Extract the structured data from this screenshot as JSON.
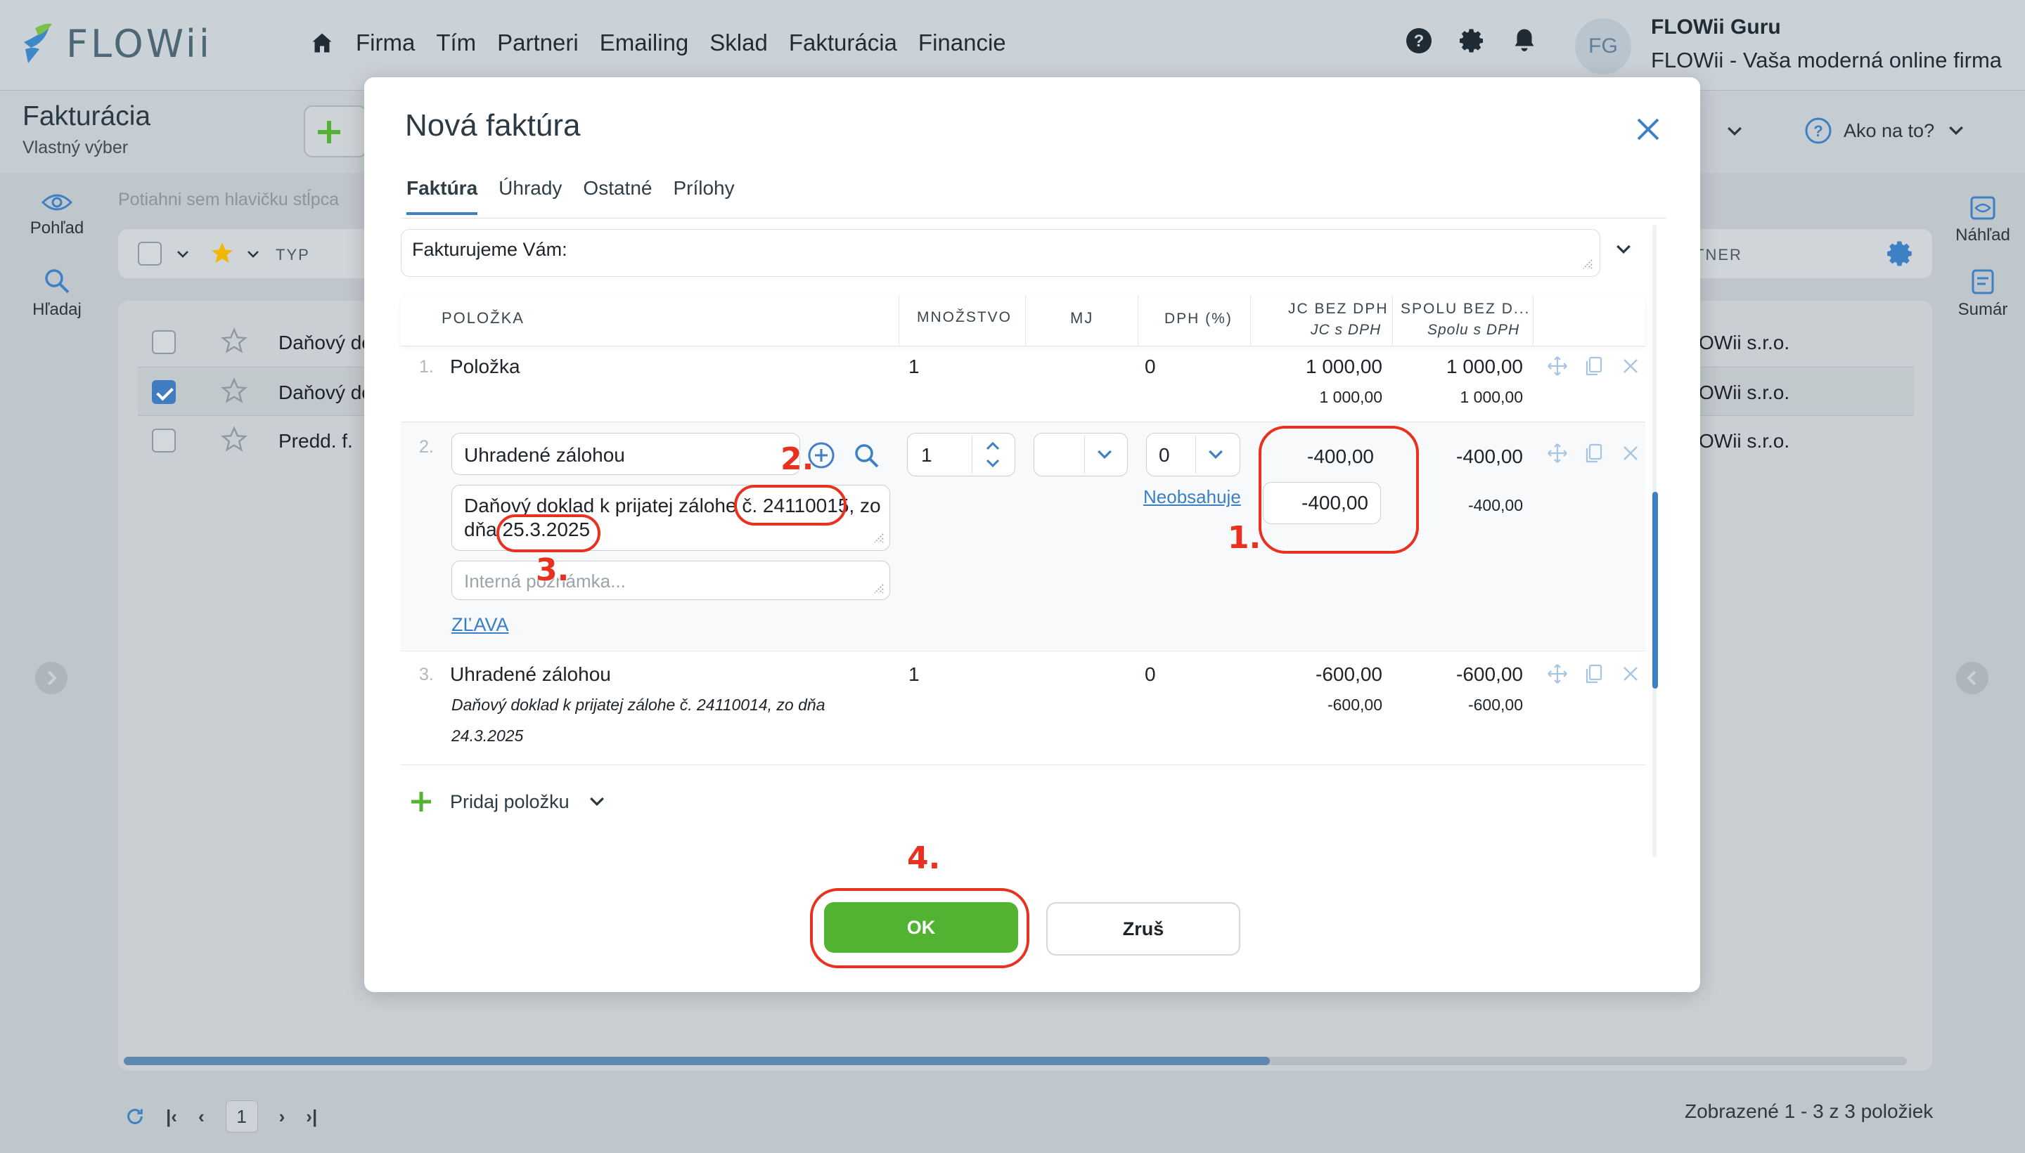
{
  "app": {
    "logo_text": "FLOWii",
    "nav": [
      "Firma",
      "Tím",
      "Partneri",
      "Emailing",
      "Sklad",
      "Fakturácia",
      "Financie"
    ],
    "user_initials": "FG",
    "user_name": "FLOWii Guru",
    "user_company": "FLOWii - Vaša moderná online firma",
    "help_label": "Ako na to?"
  },
  "page": {
    "title": "Fakturácia",
    "subtitle": "Vlastný výber",
    "drop_hint": "Potiahni sem hlavičku stĺpca",
    "filter_type_label": "TYP",
    "filter_partner_label": "TNER",
    "left_rail": [
      "Pohľad",
      "Hľadaj"
    ],
    "right_rail": [
      "Náhľad",
      "Sumár"
    ],
    "rows": [
      {
        "type": "Daňový do",
        "partner": "OWii s.r.o.",
        "checked": false
      },
      {
        "type": "Daňový do",
        "partner": "OWii s.r.o.",
        "checked": true
      },
      {
        "type": "Predd. f.",
        "partner": "OWii s.r.o.",
        "checked": false
      }
    ],
    "pager_current": "1",
    "count_text": "Zobrazené 1 - 3 z 3 položiek"
  },
  "modal": {
    "title": "Nová faktúra",
    "tabs": [
      "Faktúra",
      "Úhrady",
      "Ostatné",
      "Prílohy"
    ],
    "active_tab": "Faktúra",
    "intro_text": "Fakturujeme Vám:",
    "columns": {
      "item": "POLOŽKA",
      "qty": "MNOŽSTVO",
      "unit": "MJ",
      "vat": "DPH (%)",
      "unit_price": "JC BEZ DPH",
      "unit_price_sub": "JC s DPH",
      "total": "SPOLU BEZ D...",
      "total_sub": "Spolu s DPH"
    },
    "items": [
      {
        "no": "1.",
        "name": "Položka",
        "qty": "1",
        "vat": "0",
        "unit_price": "1 000,00",
        "unit_price_vat": "1 000,00",
        "total": "1 000,00",
        "total_vat": "1 000,00"
      },
      {
        "no": "2.",
        "name": "Uhradené zálohou",
        "description_line1": "Daňový doklad k prijatej zálohe č. 24110015, zo",
        "description_line2": "dňa 25.3.2025",
        "note_placeholder": "Interná poznámka...",
        "discount_link": "ZĽAVA",
        "qty": "1",
        "unit": "",
        "vat": "0",
        "vat_link": "Neobsahuje",
        "unit_price": "-400,00",
        "unit_price_vat": "-400,00",
        "total": "-400,00",
        "total_vat": "-400,00"
      },
      {
        "no": "3.",
        "name": "Uhradené zálohou",
        "description_line1": "Daňový doklad k prijatej zálohe č. 24110014, zo dňa",
        "description_line2": "24.3.2025",
        "qty": "1",
        "vat": "0",
        "unit_price": "-600,00",
        "unit_price_vat": "-600,00",
        "total": "-600,00",
        "total_vat": "-600,00"
      }
    ],
    "add_item_label": "Pridaj položku",
    "ok_label": "OK",
    "cancel_label": "Zruš"
  },
  "annotations": [
    "1.",
    "2.",
    "3.",
    "4."
  ],
  "colors": {
    "accent": "#3e80c4",
    "ok": "#52b332",
    "annotation": "#e8321f"
  }
}
